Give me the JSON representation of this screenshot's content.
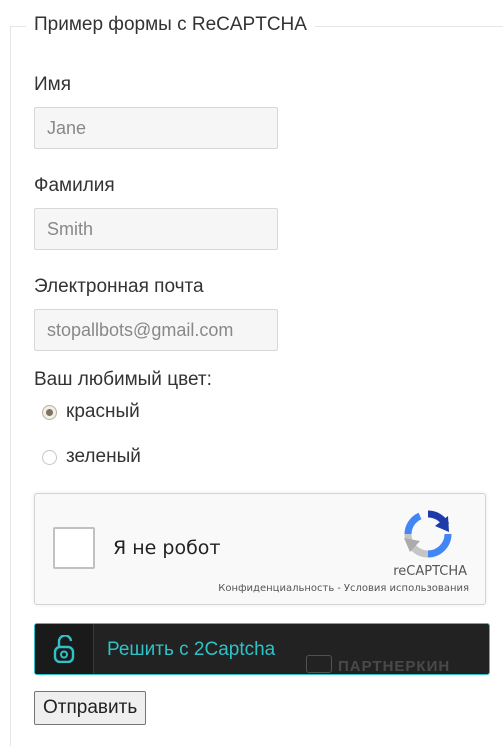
{
  "form": {
    "legend": "Пример формы с ReCAPTCHA",
    "first_name": {
      "label": "Имя",
      "value": "Jane"
    },
    "last_name": {
      "label": "Фамилия",
      "value": "Smith"
    },
    "email": {
      "label": "Электронная почта",
      "value": "stopallbots@gmail.com"
    },
    "color": {
      "label": "Ваш любимый цвет:",
      "options": [
        {
          "label": "красный",
          "checked": true
        },
        {
          "label": "зеленый",
          "checked": false
        }
      ]
    }
  },
  "recaptcha": {
    "checkbox_label": "Я не робот",
    "brand": "reCAPTCHA",
    "privacy_link": "Конфиденциальность",
    "separator": "-",
    "terms_link": "Условия использования",
    "icon": "recaptcha-logo-icon",
    "checked": false
  },
  "solver": {
    "label": "Решить с 2Captcha",
    "icon": "unlock-icon",
    "accent": "#2fc2c7",
    "watermark": "ПАРТНЕРКИН"
  },
  "submit": {
    "label": "Отправить"
  }
}
